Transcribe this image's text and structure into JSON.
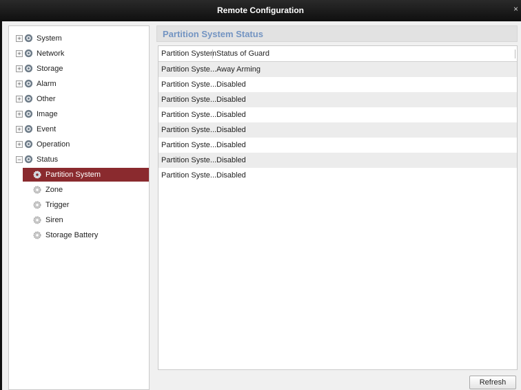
{
  "window": {
    "title": "Remote Configuration",
    "close_glyph": "×"
  },
  "sidebar": {
    "items": [
      {
        "label": "System",
        "toggle": "+"
      },
      {
        "label": "Network",
        "toggle": "+"
      },
      {
        "label": "Storage",
        "toggle": "+"
      },
      {
        "label": "Alarm",
        "toggle": "+"
      },
      {
        "label": "Other",
        "toggle": "+"
      },
      {
        "label": "Image",
        "toggle": "+"
      },
      {
        "label": "Event",
        "toggle": "+"
      },
      {
        "label": "Operation",
        "toggle": "+"
      },
      {
        "label": "Status",
        "toggle": "−"
      }
    ],
    "status_children": [
      {
        "label": "Partition System",
        "selected": true
      },
      {
        "label": "Zone"
      },
      {
        "label": "Trigger"
      },
      {
        "label": "Siren"
      },
      {
        "label": "Storage Battery"
      }
    ],
    "selected_color": "#8a2a2e"
  },
  "main": {
    "title": "Partition System Status",
    "title_color": "#7394c2",
    "columns": [
      "Partition System",
      "Status of Guard"
    ],
    "rows": [
      [
        "Partition Syste...",
        "Away Arming"
      ],
      [
        "Partition Syste...",
        "Disabled"
      ],
      [
        "Partition Syste...",
        "Disabled"
      ],
      [
        "Partition Syste...",
        "Disabled"
      ],
      [
        "Partition Syste...",
        "Disabled"
      ],
      [
        "Partition Syste...",
        "Disabled"
      ],
      [
        "Partition Syste...",
        "Disabled"
      ],
      [
        "Partition Syste...",
        "Disabled"
      ]
    ],
    "refresh_label": "Refresh"
  }
}
